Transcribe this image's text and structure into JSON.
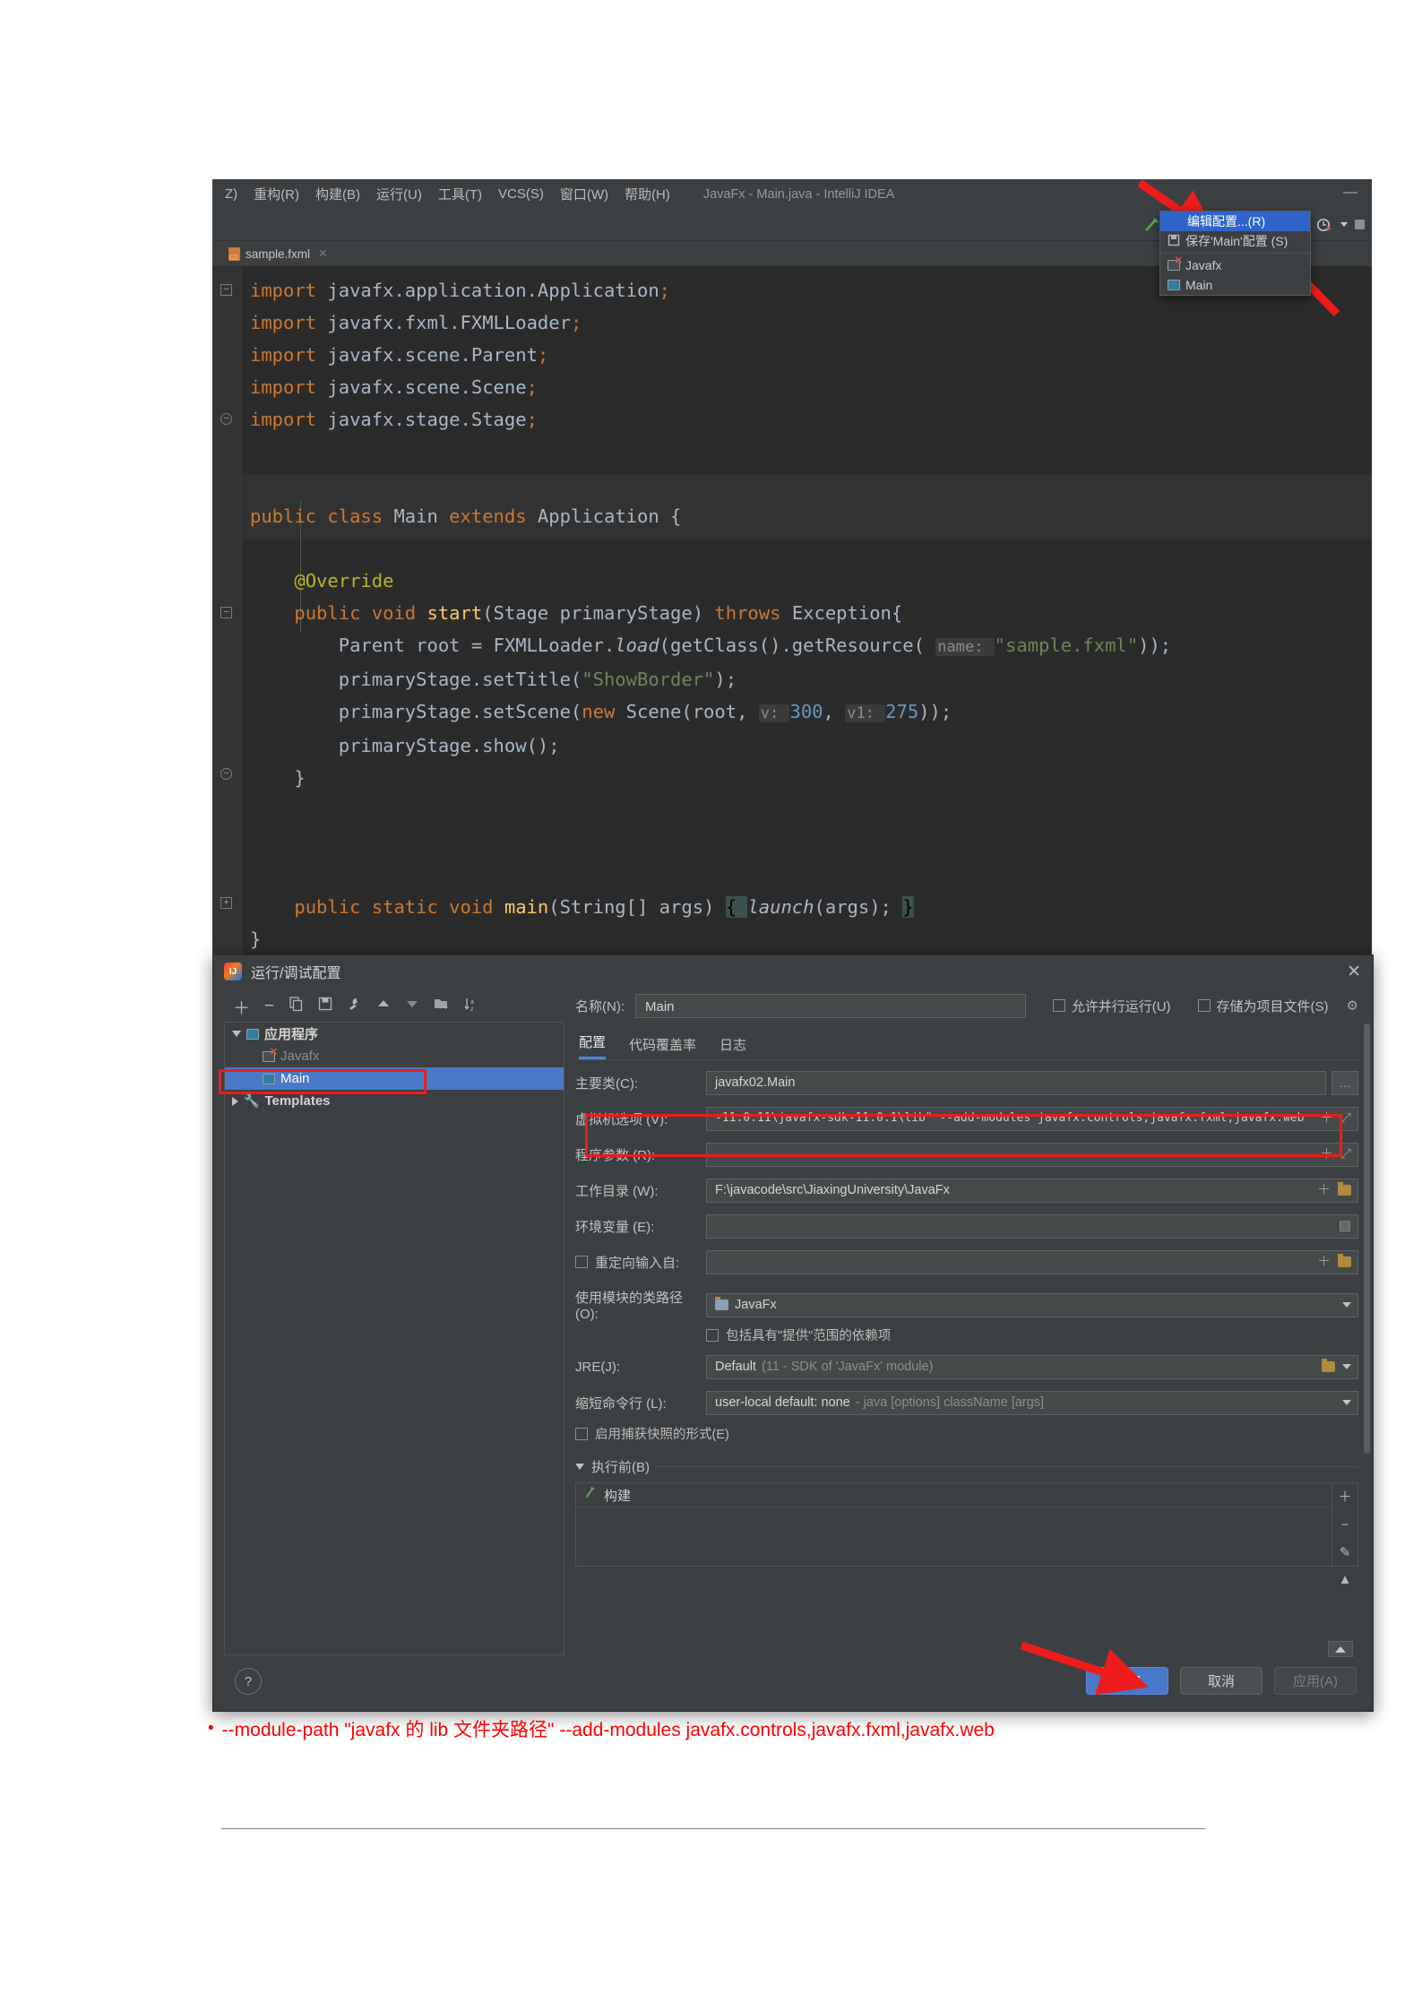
{
  "ide": {
    "menu_items": [
      {
        "label": "Z)",
        "mnemonic": ""
      },
      {
        "label": "重构(R)"
      },
      {
        "label": "构建(B)"
      },
      {
        "label": "运行(U)"
      },
      {
        "label": "工具(T)"
      },
      {
        "label": "VCS(S)"
      },
      {
        "label": "窗口(W)"
      },
      {
        "label": "帮助(H)"
      }
    ],
    "window_title": "JavaFx - Main.java - IntelliJ IDEA",
    "minimize_label": "—",
    "toolbar": {
      "build_icon": "hammer-icon",
      "run_config_name": "Main",
      "run_icon": "run-icon",
      "debug_icon": "debug-icon",
      "coverage_icon": "run-with-coverage-icon",
      "profile_icon": "profile-icon",
      "stop_icon": "stop-icon"
    },
    "run_dropdown": {
      "items": [
        {
          "label": "编辑配置...(R)",
          "selected": true,
          "icon": ""
        },
        {
          "label": "保存'Main'配置 (S)",
          "selected": false,
          "icon": "save-icon"
        },
        {
          "label": "Javafx",
          "selected": false,
          "icon": "app-error-icon"
        },
        {
          "label": "Main",
          "selected": false,
          "icon": "app-icon"
        }
      ]
    },
    "editor_tab": {
      "label": "sample.fxml",
      "icon": "fxml-file-icon",
      "close": "✕"
    },
    "code_lines": [
      {
        "fold": "minus-square",
        "parts": [
          {
            "t": "import ",
            "c": "kw"
          },
          {
            "t": "javafx.application.Application",
            "c": "id"
          },
          {
            "t": ";",
            "c": "kw"
          }
        ]
      },
      {
        "fold": "",
        "parts": [
          {
            "t": "import ",
            "c": "kw"
          },
          {
            "t": "javafx.fxml.FXMLLoader",
            "c": "id"
          },
          {
            "t": ";",
            "c": "kw"
          }
        ]
      },
      {
        "fold": "",
        "parts": [
          {
            "t": "import ",
            "c": "kw"
          },
          {
            "t": "javafx.scene.Parent",
            "c": "id"
          },
          {
            "t": ";",
            "c": "kw"
          }
        ]
      },
      {
        "fold": "",
        "parts": [
          {
            "t": "import ",
            "c": "kw"
          },
          {
            "t": "javafx.scene.Scene",
            "c": "id"
          },
          {
            "t": ";",
            "c": "kw"
          }
        ]
      },
      {
        "fold": "minus-round",
        "parts": [
          {
            "t": "import ",
            "c": "kw"
          },
          {
            "t": "javafx.stage.Stage",
            "c": "id"
          },
          {
            "t": ";",
            "c": "kw"
          }
        ]
      },
      {
        "fold": "",
        "parts": []
      },
      {
        "fold": "",
        "parts": []
      },
      {
        "fold": "",
        "parts": [
          {
            "t": "public class ",
            "c": "kw"
          },
          {
            "t": "Main ",
            "c": "id"
          },
          {
            "t": "extends ",
            "c": "kw"
          },
          {
            "t": "Application ",
            "c": "id"
          },
          {
            "t": "{",
            "c": "brc"
          }
        ]
      },
      {
        "fold": "",
        "parts": []
      },
      {
        "fold": "",
        "parts": [
          {
            "t": "    @Override",
            "c": "ann"
          }
        ]
      },
      {
        "fold": "minus-square",
        "parts": [
          {
            "t": "    public void ",
            "c": "kw"
          },
          {
            "t": "start",
            "c": "mth"
          },
          {
            "t": "(",
            "c": "brc"
          },
          {
            "t": "Stage primaryStage",
            "c": "id"
          },
          {
            "t": ") ",
            "c": "brc"
          },
          {
            "t": "throws ",
            "c": "kw"
          },
          {
            "t": "Exception",
            "c": "id"
          },
          {
            "t": "{",
            "c": "brc"
          }
        ]
      },
      {
        "fold": "",
        "parts": [
          {
            "t": "        Parent root = FXMLLoader.",
            "c": "id"
          },
          {
            "t": "load",
            "c": "itl"
          },
          {
            "t": "(",
            "c": "brc"
          },
          {
            "t": "getClass",
            "c": "id"
          },
          {
            "t": "()",
            "c": "brc"
          },
          {
            "t": ".getResource",
            "c": "id"
          },
          {
            "t": "( ",
            "c": "brc"
          },
          {
            "t": "name: ",
            "c": "hint"
          },
          {
            "t": "\"sample.fxml\"",
            "c": "str"
          },
          {
            "t": "));",
            "c": "brc"
          }
        ]
      },
      {
        "fold": "",
        "parts": [
          {
            "t": "        primaryStage.setTitle",
            "c": "id"
          },
          {
            "t": "(",
            "c": "brc"
          },
          {
            "t": "\"ShowBorder\"",
            "c": "str"
          },
          {
            "t": ");",
            "c": "brc"
          }
        ]
      },
      {
        "fold": "",
        "parts": [
          {
            "t": "        primaryStage.setScene",
            "c": "id"
          },
          {
            "t": "(",
            "c": "brc"
          },
          {
            "t": "new ",
            "c": "kw"
          },
          {
            "t": "Scene",
            "c": "id"
          },
          {
            "t": "(root, ",
            "c": "brc"
          },
          {
            "t": "v: ",
            "c": "hint"
          },
          {
            "t": "300",
            "c": "num"
          },
          {
            "t": ", ",
            "c": "brc"
          },
          {
            "t": "v1: ",
            "c": "hint"
          },
          {
            "t": "275",
            "c": "num"
          },
          {
            "t": "));",
            "c": "brc"
          }
        ]
      },
      {
        "fold": "",
        "parts": [
          {
            "t": "        primaryStage.show",
            "c": "id"
          },
          {
            "t": "();",
            "c": "brc"
          }
        ]
      },
      {
        "fold": "minus-round",
        "parts": [
          {
            "t": "    }",
            "c": "brc"
          }
        ]
      },
      {
        "fold": "",
        "parts": []
      },
      {
        "fold": "",
        "parts": []
      },
      {
        "fold": "",
        "parts": []
      },
      {
        "fold": "plus-square",
        "parts": [
          {
            "t": "    public static void ",
            "c": "kw"
          },
          {
            "t": "main",
            "c": "mth"
          },
          {
            "t": "(",
            "c": "brc"
          },
          {
            "t": "String",
            "c": "id"
          },
          {
            "t": "[] args) ",
            "c": "id"
          },
          {
            "t": "{ ",
            "c": "hl-brace"
          },
          {
            "t": "launch",
            "c": "itl"
          },
          {
            "t": "(args); ",
            "c": "id"
          },
          {
            "t": "}",
            "c": "hl-brace"
          }
        ]
      },
      {
        "fold": "",
        "parts": [
          {
            "t": "}",
            "c": "brc"
          }
        ]
      }
    ]
  },
  "dialog": {
    "title": "运行/调试配置",
    "close_label": "✕",
    "left_toolbar_icons": [
      "add-icon",
      "remove-icon",
      "copy-icon",
      "save-icon",
      "wrench-icon",
      "move-up-icon",
      "move-down-icon",
      "new-folder-icon",
      "sort-icon"
    ],
    "tree": [
      {
        "label": "应用程序",
        "level": 0,
        "expanded": true,
        "bold": true,
        "icon": "app-icon",
        "selected": false
      },
      {
        "label": "Javafx",
        "level": 1,
        "icon": "app-error-icon",
        "selected": false,
        "dim": true
      },
      {
        "label": "Main",
        "level": 1,
        "icon": "app-icon",
        "selected": true
      },
      {
        "label": "Templates",
        "level": 0,
        "expanded": false,
        "bold": true,
        "icon": "wrench-icon",
        "selected": false
      }
    ],
    "name_label": "名称(N):",
    "name_value": "Main",
    "checkbox_parallel": "允许并行运行(U)",
    "checkbox_store": "存储为项目文件(S)",
    "gear_icon": "gear-icon",
    "tabs": [
      {
        "label": "配置",
        "active": true
      },
      {
        "label": "代码覆盖率",
        "active": false
      },
      {
        "label": "日志",
        "active": false
      }
    ],
    "fields": [
      {
        "label": "主要类(C):",
        "value": "javafx02.Main",
        "trailing": "ellipsis-button",
        "mono": false
      },
      {
        "label": "虚拟机选项 (V):",
        "value": "-11.0.11\\javafx-sdk-11.0.1\\lib\" --add-modules javafx.controls,javafx.fxml,javafx.web",
        "trailing": "expand-icons",
        "mono": true,
        "highlight": true
      },
      {
        "label": "程序参数 (R):",
        "value": "",
        "trailing": "expand-icons",
        "mono": false
      },
      {
        "label": "工作目录 (W):",
        "value": "F:\\javacode\\src\\JiaxingUniversity\\JavaFx",
        "trailing": "folder-icons",
        "mono": false
      },
      {
        "label": "环境变量 (E):",
        "value": "",
        "trailing": "env-icon",
        "mono": false
      }
    ],
    "redirect_label": "重定向输入自:",
    "redirect_value": "",
    "module_classpath_label": "使用模块的类路径 (O):",
    "module_classpath_value": "JavaFx",
    "include_provided_label": "包括具有\"提供\"范围的依赖项",
    "jre_label": "JRE(J):",
    "jre_value": "Default",
    "jre_value_dim": "(11 - SDK of 'JavaFx' module)",
    "shorten_label": "缩短命令行 (L):",
    "shorten_value": "user-local default: none",
    "shorten_value_dim": "- java [options] className [args]",
    "snapshot_label": "启用捕获快照的形式(E)",
    "before_launch_label": "执行前(B)",
    "before_launch_item": "构建",
    "before_side_icons": [
      "add-icon",
      "remove-icon",
      "edit-icon",
      "move-up-icon"
    ],
    "help_label": "?",
    "buttons": [
      {
        "label": "确定",
        "kind": "primary"
      },
      {
        "label": "取消",
        "kind": "normal"
      },
      {
        "label": "应用(A)",
        "kind": "disabled"
      }
    ]
  },
  "caption": {
    "bullet": "•",
    "text": "--module-path \"javafx 的 lib 文件夹路径\" --add-modules javafx.controls,javafx.fxml,javafx.web",
    "color": "#ff0000"
  },
  "annotations": {
    "arrow_color": "#ee1c1c",
    "arrows": [
      "toolbar-config-arrow",
      "dropdown-edit-arrow",
      "ok-button-arrow"
    ],
    "boxes": [
      "main-tree-item-box",
      "vm-options-box"
    ]
  }
}
